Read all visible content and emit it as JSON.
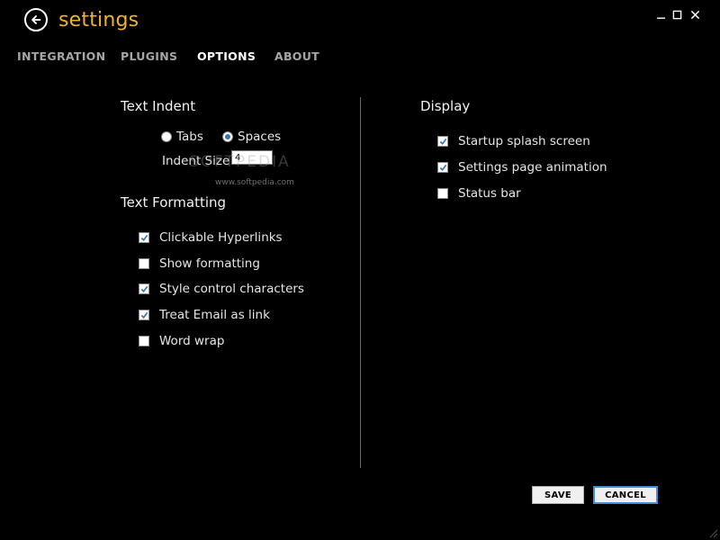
{
  "window": {
    "title": "settings",
    "controls": [
      "minimize",
      "maximize",
      "close"
    ]
  },
  "tabs": [
    {
      "label": "INTEGRATION",
      "active": false
    },
    {
      "label": "PLUGINS",
      "active": false
    },
    {
      "label": "OPTIONS",
      "active": true
    },
    {
      "label": "ABOUT",
      "active": false
    }
  ],
  "text_indent": {
    "title": "Text Indent",
    "tabs_label": "Tabs",
    "spaces_label": "Spaces",
    "selected": "Spaces",
    "indent_size_label": "Indent Size",
    "indent_size_value": "4"
  },
  "text_formatting": {
    "title": "Text Formatting",
    "options": [
      {
        "label": "Clickable Hyperlinks",
        "checked": true
      },
      {
        "label": "Show formatting",
        "checked": false
      },
      {
        "label": "Style control characters",
        "checked": true
      },
      {
        "label": "Treat Email as link",
        "checked": true
      },
      {
        "label": "Word wrap",
        "checked": false
      }
    ]
  },
  "display": {
    "title": "Display",
    "options": [
      {
        "label": "Startup splash screen",
        "checked": true
      },
      {
        "label": "Settings page animation",
        "checked": true
      },
      {
        "label": "Status bar",
        "checked": false
      }
    ]
  },
  "buttons": {
    "save_label": "SAVE",
    "cancel_label": "CANCEL"
  },
  "watermark": {
    "brand": "SOFTPEDIA",
    "url": "www.softpedia.com"
  },
  "colors": {
    "background": "#000000",
    "title_accent": "#f0b429",
    "check_accent": "#3a73b8",
    "button_focus": "#3c8fd8"
  }
}
